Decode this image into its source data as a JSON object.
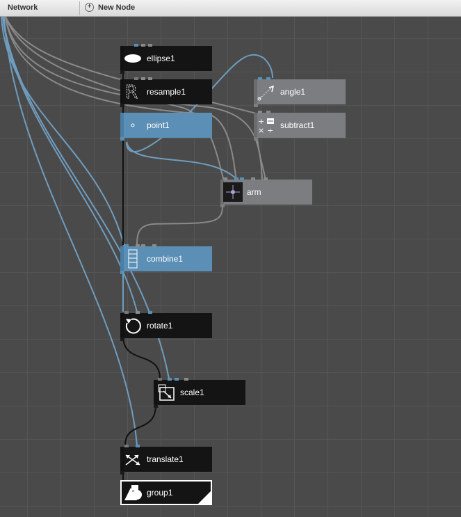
{
  "toolbar": {
    "network_label": "Network",
    "new_node_label": "New Node",
    "new_node_icon": "plus-circle-icon"
  },
  "nodes": {
    "ellipse1": {
      "label": "ellipse1",
      "icon": "ellipse-icon",
      "style": "dark"
    },
    "resample1": {
      "label": "resample1",
      "icon": "resample-icon",
      "style": "dark"
    },
    "point1": {
      "label": "point1",
      "icon": "point-icon",
      "style": "blue"
    },
    "angle1": {
      "label": "angle1",
      "icon": "angle-icon",
      "style": "gray"
    },
    "subtract1": {
      "label": "subtract1",
      "icon": "math-icon",
      "style": "gray"
    },
    "arm": {
      "label": "arm",
      "icon": "arm-icon",
      "style": "gray"
    },
    "combine1": {
      "label": "combine1",
      "icon": "combine-icon",
      "style": "blue"
    },
    "rotate1": {
      "label": "rotate1",
      "icon": "rotate-icon",
      "style": "dark"
    },
    "scale1": {
      "label": "scale1",
      "icon": "scale-icon",
      "style": "dark"
    },
    "translate1": {
      "label": "translate1",
      "icon": "translate-icon",
      "style": "dark"
    },
    "group1": {
      "label": "group1",
      "icon": "group-icon",
      "style": "selected-rendered"
    }
  },
  "colors": {
    "canvas": "#4a4a4a",
    "grid": "#555555",
    "node_dark": "#141414",
    "node_blue": "#5b8fb5",
    "node_gray": "#7b7d80",
    "wire_blue": "#6f9dbf",
    "wire_gray": "#8a8a8a",
    "wire_black": "#111111"
  }
}
